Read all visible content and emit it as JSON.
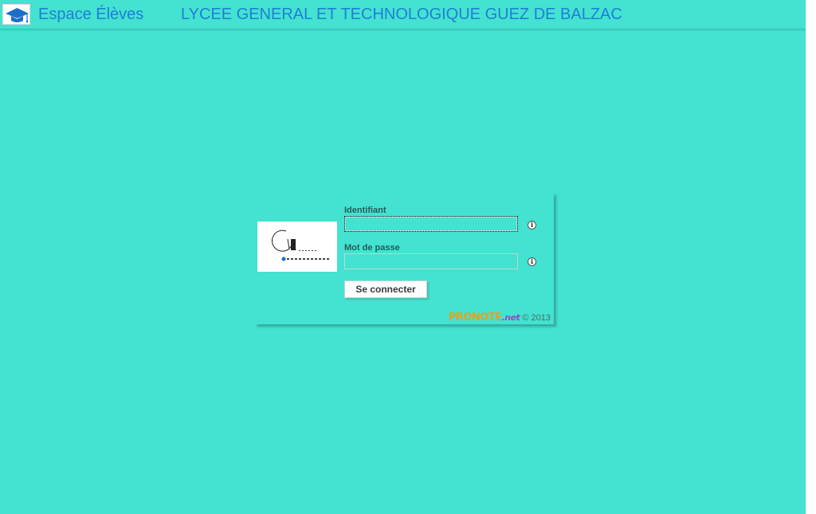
{
  "header": {
    "app_title": "Espace Élèves",
    "school_name": "LYCEE GENERAL ET TECHNOLOGIQUE GUEZ DE BALZAC"
  },
  "login": {
    "username_label": "Identifiant",
    "username_value": "",
    "password_label": "Mot de passe",
    "password_value": "",
    "info_symbol": "i",
    "submit_label": "Se connecter"
  },
  "footer": {
    "brand_part1": "PRONOTE",
    "brand_part2": ".net",
    "copyright": "© 2013"
  },
  "icons": {
    "app": "graduation-cap-icon",
    "info": "info-icon"
  },
  "colors": {
    "background": "#43e2d1",
    "title": "#1f7fd6"
  }
}
